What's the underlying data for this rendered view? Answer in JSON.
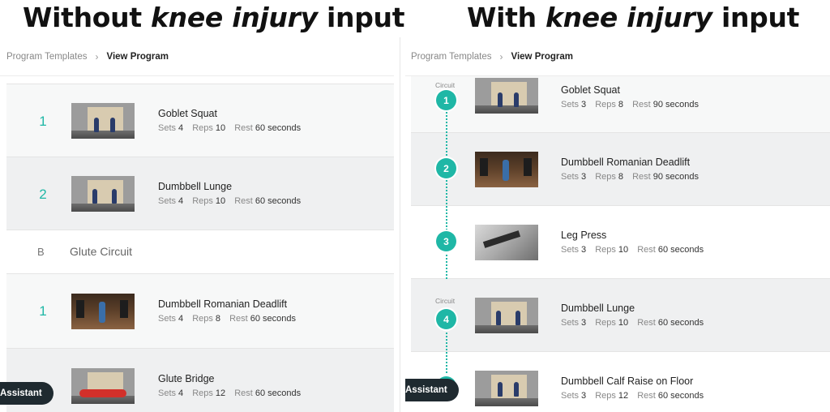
{
  "titles": {
    "left": {
      "prefix": "Without ",
      "emph": "knee injury",
      "suffix": " input"
    },
    "right": {
      "prefix": "With ",
      "emph": "knee injury",
      "suffix": " input"
    }
  },
  "breadcrumb": {
    "link": "Program Templates",
    "separator": "›",
    "current": "View Program"
  },
  "labels": {
    "sets": "Sets",
    "reps": "Reps",
    "rest": "Rest",
    "circuit": "Circuit",
    "assistant": "Assistant"
  },
  "left_panel": {
    "exercises": [
      {
        "index": "1",
        "name": "Goblet Squat",
        "sets": "4",
        "reps": "10",
        "rest": "60 seconds"
      },
      {
        "index": "2",
        "name": "Dumbbell Lunge",
        "sets": "4",
        "reps": "10",
        "rest": "60 seconds"
      },
      {
        "index": "1",
        "name": "Dumbbell Romanian Deadlift",
        "sets": "4",
        "reps": "8",
        "rest": "60 seconds"
      },
      {
        "index": "",
        "name": "Glute Bridge",
        "sets": "4",
        "reps": "12",
        "rest": "60 seconds"
      }
    ],
    "section": {
      "letter": "B",
      "title": "Glute Circuit"
    }
  },
  "right_panel": {
    "exercises": [
      {
        "index": "1",
        "name": "Goblet Squat",
        "sets": "3",
        "reps": "8",
        "rest": "90 seconds"
      },
      {
        "index": "2",
        "name": "Dumbbell Romanian Deadlift",
        "sets": "3",
        "reps": "8",
        "rest": "90 seconds"
      },
      {
        "index": "3",
        "name": "Leg Press",
        "sets": "3",
        "reps": "10",
        "rest": "60 seconds"
      },
      {
        "index": "4",
        "name": "Dumbbell Lunge",
        "sets": "3",
        "reps": "10",
        "rest": "60 seconds"
      },
      {
        "index": "",
        "name": "Dumbbell Calf Raise on Floor",
        "sets": "3",
        "reps": "12",
        "rest": "60 seconds"
      }
    ]
  },
  "colors": {
    "accent": "#1fb7a6",
    "assistant_bg": "#1f2a30"
  },
  "icons": {
    "thumbnail": "exercise-video-thumbnail"
  }
}
